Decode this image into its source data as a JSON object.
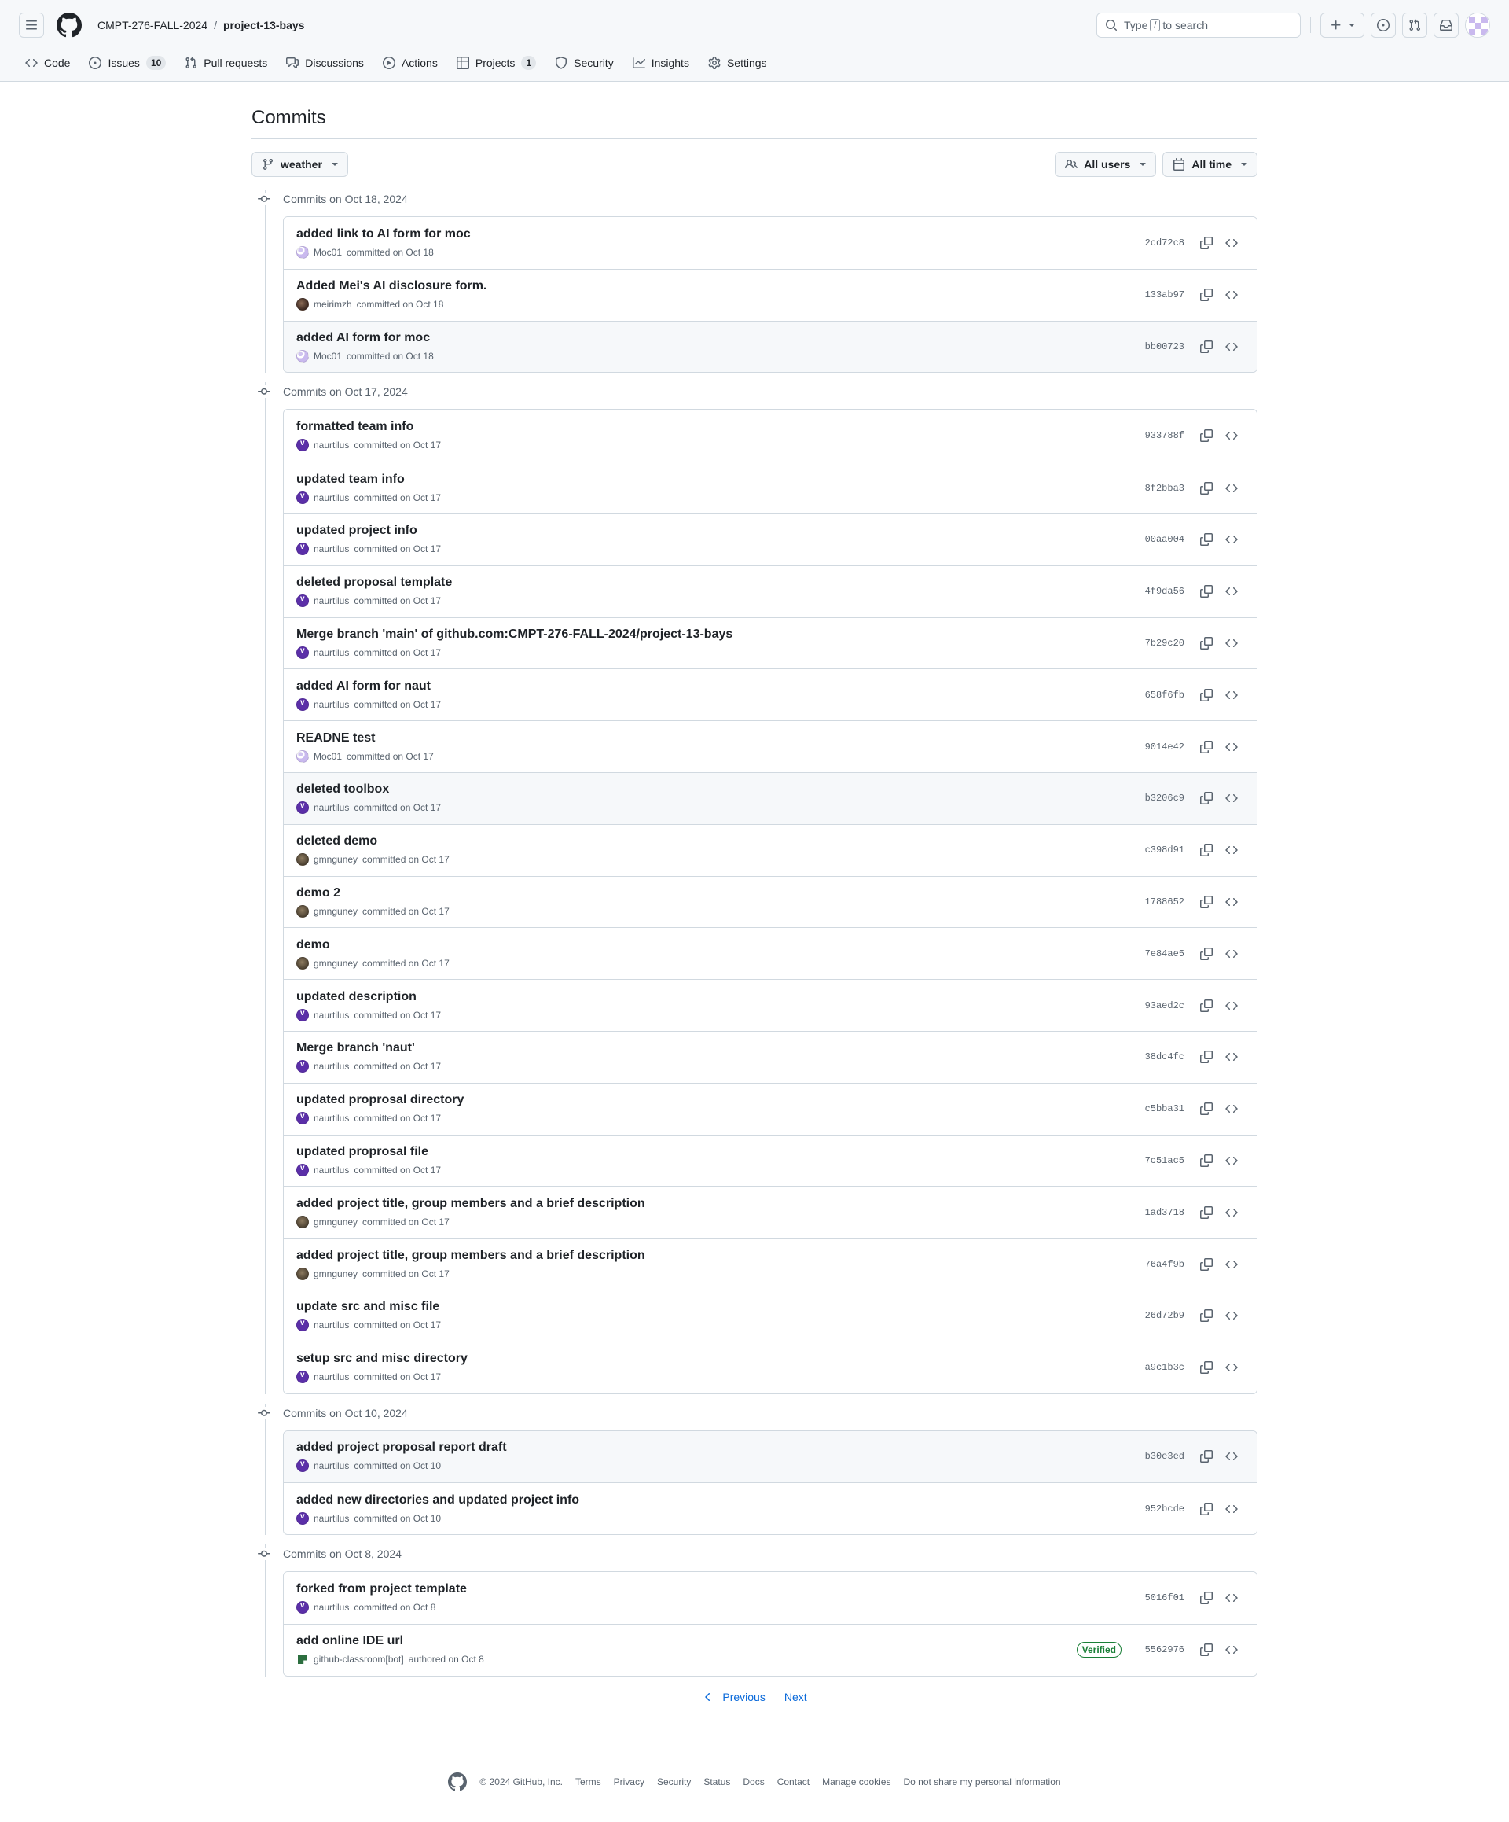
{
  "header": {
    "owner": "CMPT-276-FALL-2024",
    "separator": "/",
    "repo": "project-13-bays",
    "search_prefix": "Type",
    "search_key": "/",
    "search_suffix": "to search"
  },
  "nav": [
    {
      "label": "Code",
      "icon": "code-icon"
    },
    {
      "label": "Issues",
      "icon": "issue-icon",
      "count": "10"
    },
    {
      "label": "Pull requests",
      "icon": "pull-request-icon"
    },
    {
      "label": "Discussions",
      "icon": "discussion-icon"
    },
    {
      "label": "Actions",
      "icon": "play-icon"
    },
    {
      "label": "Projects",
      "icon": "table-icon",
      "count": "1"
    },
    {
      "label": "Security",
      "icon": "shield-icon"
    },
    {
      "label": "Insights",
      "icon": "graph-icon"
    },
    {
      "label": "Settings",
      "icon": "gear-icon"
    }
  ],
  "page_title": "Commits",
  "filters": {
    "branch": "weather",
    "users": "All users",
    "time": "All time"
  },
  "groups": [
    {
      "heading": "Commits on Oct 18, 2024",
      "commits": [
        {
          "title": "added link to AI form for moc",
          "author": "Moc01",
          "avatar": "moc",
          "action": "committed on Oct 18",
          "sha": "2cd72c8"
        },
        {
          "title": "Added Mei's AI disclosure form.",
          "author": "meirimzh",
          "avatar": "mei",
          "action": "committed on Oct 18",
          "sha": "133ab97"
        },
        {
          "title": "added AI form for moc",
          "author": "Moc01",
          "avatar": "moc",
          "action": "committed on Oct 18",
          "sha": "bb00723",
          "hl": true
        }
      ]
    },
    {
      "heading": "Commits on Oct 17, 2024",
      "commits": [
        {
          "title": "formatted team info",
          "author": "naurtilus",
          "avatar": "naut",
          "action": "committed on Oct 17",
          "sha": "933788f"
        },
        {
          "title": "updated team info",
          "author": "naurtilus",
          "avatar": "naut",
          "action": "committed on Oct 17",
          "sha": "8f2bba3"
        },
        {
          "title": "updated project info",
          "author": "naurtilus",
          "avatar": "naut",
          "action": "committed on Oct 17",
          "sha": "00aa004"
        },
        {
          "title": "deleted proposal template",
          "author": "naurtilus",
          "avatar": "naut",
          "action": "committed on Oct 17",
          "sha": "4f9da56"
        },
        {
          "title": "Merge branch 'main' of github.com:CMPT-276-FALL-2024/project-13-bays",
          "author": "naurtilus",
          "avatar": "naut",
          "action": "committed on Oct 17",
          "sha": "7b29c20"
        },
        {
          "title": "added AI form for naut",
          "author": "naurtilus",
          "avatar": "naut",
          "action": "committed on Oct 17",
          "sha": "658f6fb"
        },
        {
          "title": "READNE test",
          "author": "Moc01",
          "avatar": "moc",
          "action": "committed on Oct 17",
          "sha": "9014e42"
        },
        {
          "title": "deleted toolbox",
          "author": "naurtilus",
          "avatar": "naut",
          "action": "committed on Oct 17",
          "sha": "b3206c9",
          "hl": true
        },
        {
          "title": "deleted demo",
          "author": "gmnguney",
          "avatar": "gmn",
          "action": "committed on Oct 17",
          "sha": "c398d91"
        },
        {
          "title": "demo 2",
          "author": "gmnguney",
          "avatar": "gmn",
          "action": "committed on Oct 17",
          "sha": "1788652"
        },
        {
          "title": "demo",
          "author": "gmnguney",
          "avatar": "gmn",
          "action": "committed on Oct 17",
          "sha": "7e84ae5"
        },
        {
          "title": "updated description",
          "author": "naurtilus",
          "avatar": "naut",
          "action": "committed on Oct 17",
          "sha": "93aed2c"
        },
        {
          "title": "Merge branch 'naut'",
          "author": "naurtilus",
          "avatar": "naut",
          "action": "committed on Oct 17",
          "sha": "38dc4fc"
        },
        {
          "title": "updated proprosal directory",
          "author": "naurtilus",
          "avatar": "naut",
          "action": "committed on Oct 17",
          "sha": "c5bba31"
        },
        {
          "title": "updated proprosal file",
          "author": "naurtilus",
          "avatar": "naut",
          "action": "committed on Oct 17",
          "sha": "7c51ac5"
        },
        {
          "title": "added project title, group members and a brief description",
          "author": "gmnguney",
          "avatar": "gmn",
          "action": "committed on Oct 17",
          "sha": "1ad3718"
        },
        {
          "title": "added project title, group members and a brief description",
          "author": "gmnguney",
          "avatar": "gmn",
          "action": "committed on Oct 17",
          "sha": "76a4f9b"
        },
        {
          "title": "update src and misc file",
          "author": "naurtilus",
          "avatar": "naut",
          "action": "committed on Oct 17",
          "sha": "26d72b9"
        },
        {
          "title": "setup src and misc directory",
          "author": "naurtilus",
          "avatar": "naut",
          "action": "committed on Oct 17",
          "sha": "a9c1b3c"
        }
      ]
    },
    {
      "heading": "Commits on Oct 10, 2024",
      "commits": [
        {
          "title": "added project proposal report draft",
          "author": "naurtilus",
          "avatar": "naut",
          "action": "committed on Oct 10",
          "sha": "b30e3ed",
          "hl": true
        },
        {
          "title": "added new directories and updated project info",
          "author": "naurtilus",
          "avatar": "naut",
          "action": "committed on Oct 10",
          "sha": "952bcde"
        }
      ]
    },
    {
      "heading": "Commits on Oct 8, 2024",
      "commits": [
        {
          "title": "forked from project template",
          "author": "naurtilus",
          "avatar": "naut",
          "action": "committed on Oct 8",
          "sha": "5016f01"
        },
        {
          "title": "add online IDE url",
          "author": "github-classroom[bot]",
          "avatar": "bot",
          "action": "authored on Oct 8",
          "sha": "5562976",
          "badge": "Verified"
        }
      ]
    }
  ],
  "pagination": {
    "previous": "Previous",
    "next": "Next"
  },
  "footer": {
    "copyright": "© 2024 GitHub, Inc.",
    "links": [
      "Terms",
      "Privacy",
      "Security",
      "Status",
      "Docs",
      "Contact",
      "Manage cookies",
      "Do not share my personal information"
    ]
  },
  "colors": {
    "accent": "#0969da",
    "verified": "#1a7f37",
    "border": "#d1d9e0"
  }
}
